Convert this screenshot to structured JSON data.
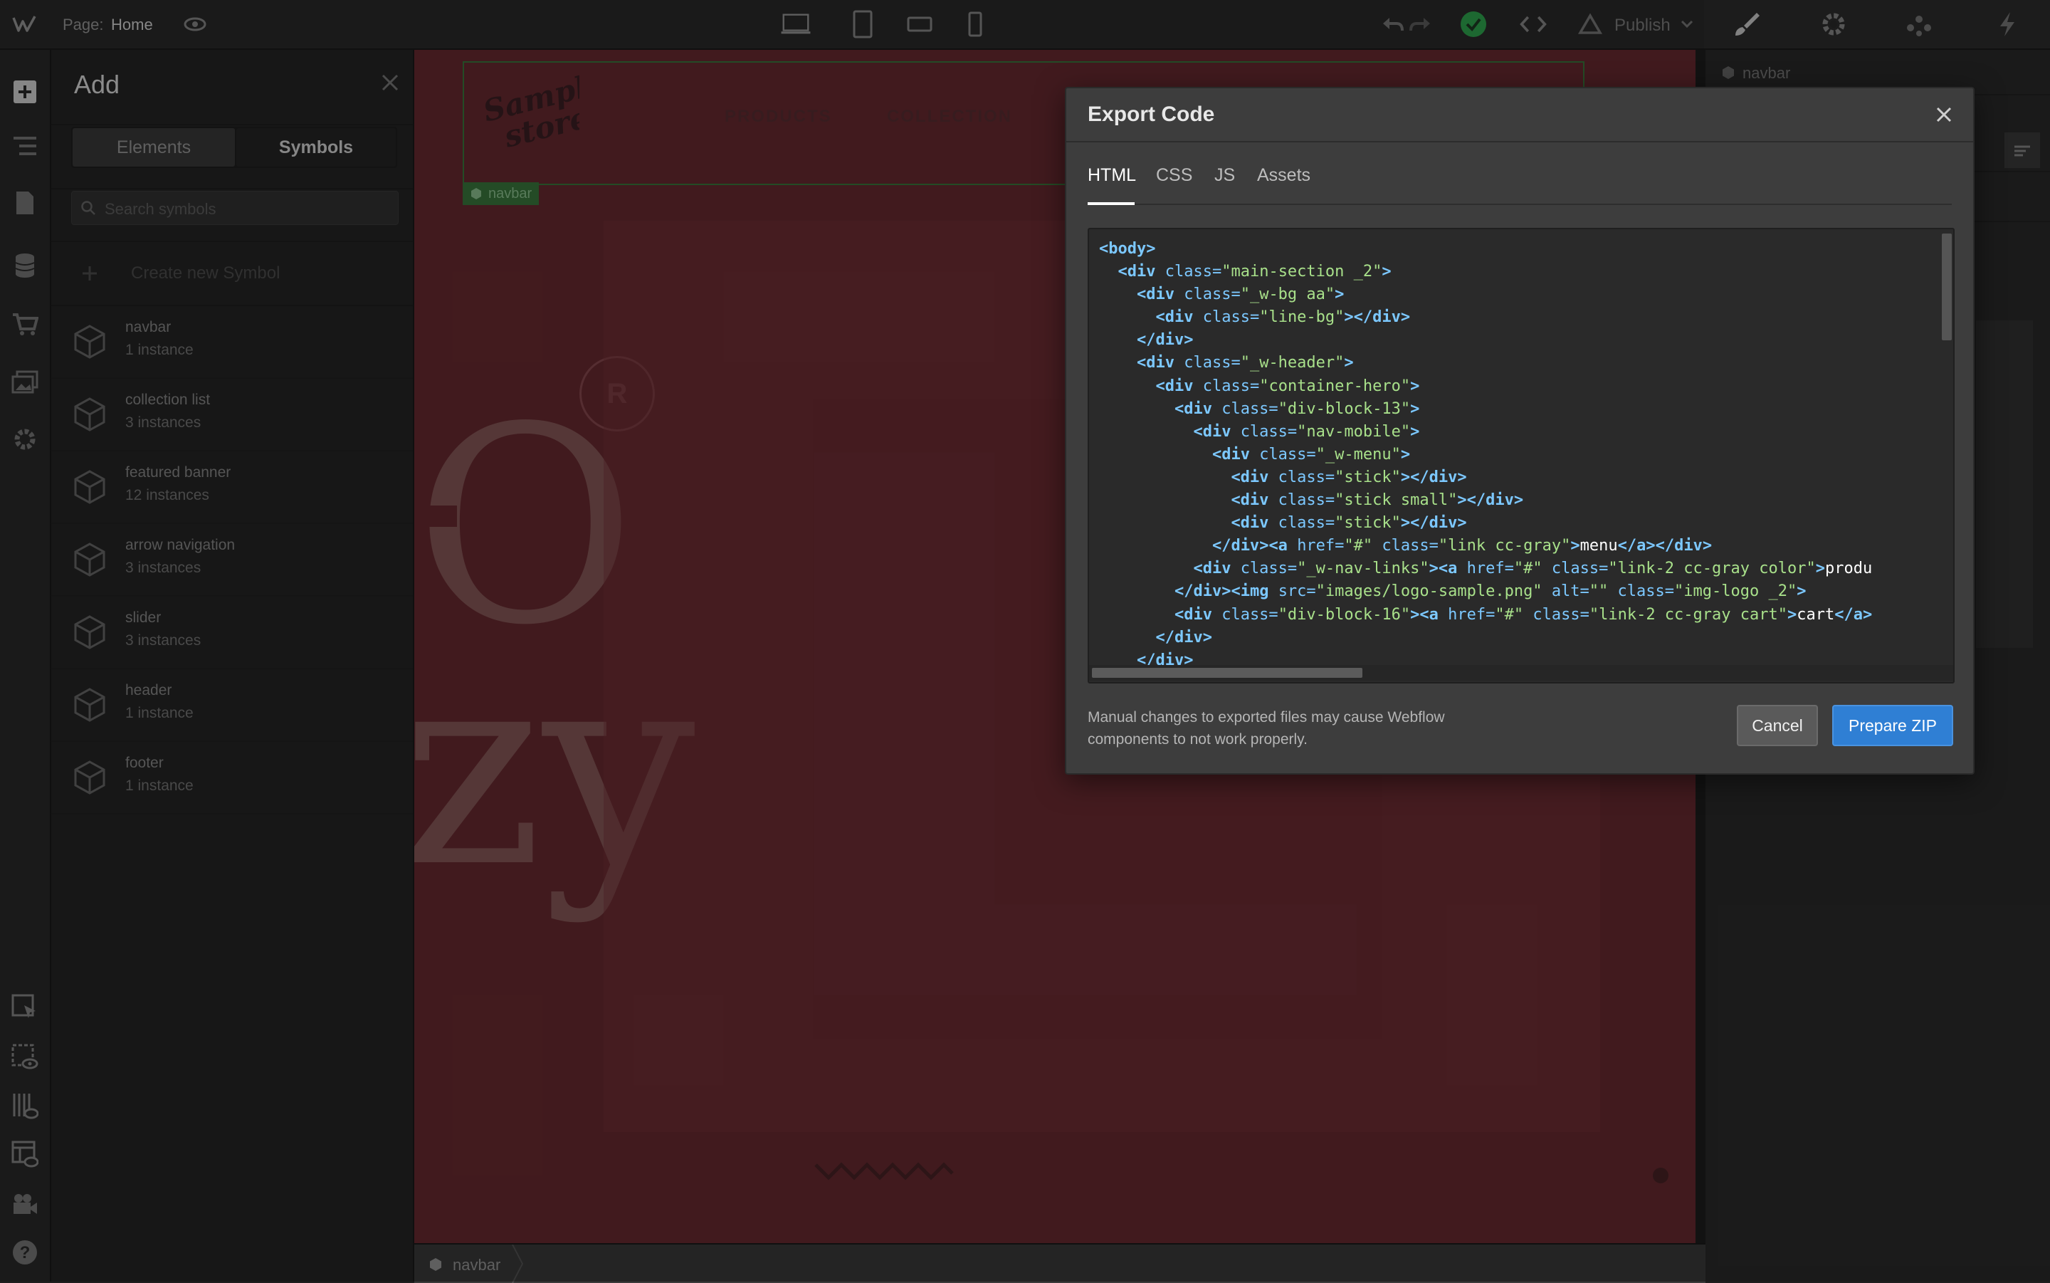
{
  "topbar": {
    "page_label": "Page:",
    "page_name": "Home",
    "publish_label": "Publish"
  },
  "add_panel": {
    "title": "Add",
    "tabs": [
      {
        "label": "Elements"
      },
      {
        "label": "Symbols"
      }
    ],
    "search_placeholder": "Search symbols",
    "create_label": "Create new Symbol",
    "symbols": [
      {
        "name": "navbar",
        "count": "1 instance"
      },
      {
        "name": "collection list",
        "count": "3 instances"
      },
      {
        "name": "featured banner",
        "count": "12 instances"
      },
      {
        "name": "arrow navigation",
        "count": "3 instances"
      },
      {
        "name": "slider",
        "count": "3 instances"
      },
      {
        "name": "header",
        "count": "1 instance"
      },
      {
        "name": "footer",
        "count": "1 instance"
      }
    ]
  },
  "canvas": {
    "logo_line1": "Sample",
    "logo_line2": "store",
    "nav_links": [
      {
        "label": "PRODUCTS"
      },
      {
        "label": "COLLECTION"
      }
    ],
    "selected_tag": "navbar",
    "big_letters": "O",
    "big_letters2": "zy",
    "r_badge": "R"
  },
  "right_panel": {
    "selected_label": "navbar"
  },
  "breadcrumb": {
    "item": "navbar"
  },
  "modal": {
    "title": "Export Code",
    "tabs": [
      {
        "label": "HTML"
      },
      {
        "label": "CSS"
      },
      {
        "label": "JS"
      },
      {
        "label": "Assets"
      }
    ],
    "code_lines": [
      "<body>",
      "  <div class=\"main-section _2\">",
      "    <div class=\"_w-bg aa\">",
      "      <div class=\"line-bg\"></div>",
      "    </div>",
      "    <div class=\"_w-header\">",
      "      <div class=\"container-hero\">",
      "        <div class=\"div-block-13\">",
      "          <div class=\"nav-mobile\">",
      "            <div class=\"_w-menu\">",
      "              <div class=\"stick\"></div>",
      "              <div class=\"stick small\"></div>",
      "              <div class=\"stick\"></div>",
      "            </div><a href=\"#\" class=\"link cc-gray\">menu</a></div>",
      "          <div class=\"_w-nav-links\"><a href=\"#\" class=\"link-2 cc-gray color\">produ",
      "        </div><img src=\"images/logo-sample.png\" alt=\"\" class=\"img-logo _2\">",
      "        <div class=\"div-block-16\"><a href=\"#\" class=\"link-2 cc-gray cart\">cart</a>",
      "      </div>",
      "    </div>"
    ],
    "note": "Manual changes to exported files may cause Webflow components to not work properly.",
    "cancel_label": "Cancel",
    "prepare_label": "Prepare ZIP"
  },
  "colors": {
    "accent": "#2f7fd4",
    "canvas_bg": "#6a2b31",
    "code_tag": "#7cc8ff",
    "code_value": "#a8e08a",
    "status_green": "#2fa84f"
  }
}
